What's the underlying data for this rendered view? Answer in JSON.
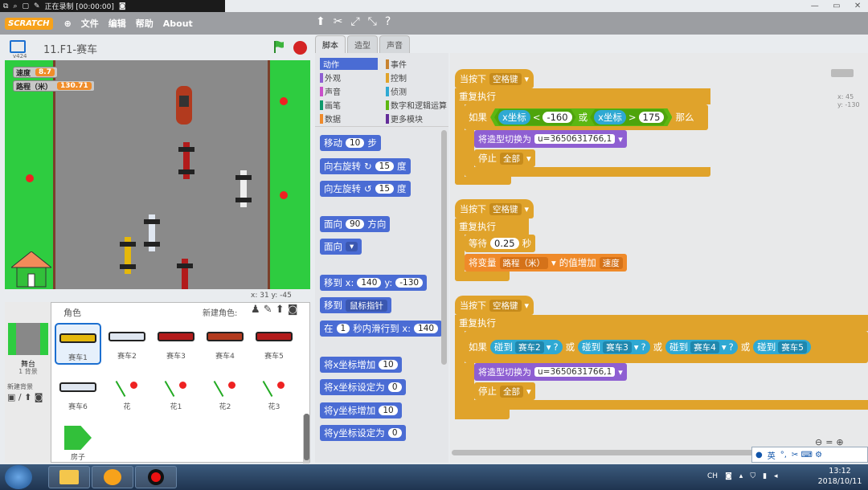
{
  "recording": {
    "status": "正在录制 [00:00:00]"
  },
  "menu": {
    "logo": "SCRATCH",
    "file": "文件",
    "edit": "编辑",
    "help": "帮助",
    "about": "About"
  },
  "stage": {
    "version": "v424",
    "title": "11.F1-赛车",
    "coords": "x: 31   y: -45",
    "var_speed_label": "速度",
    "var_speed_value": "8.7",
    "var_dist_label": "路程（米）",
    "var_dist_value": "130.71"
  },
  "sprites": {
    "header": "角色",
    "new_sprite": "新建角色:",
    "stage_label": "舞台",
    "backdrops": "1 背景",
    "new_backdrop": "新建背景",
    "items": [
      "赛车1",
      "赛车2",
      "赛车3",
      "赛车4",
      "赛车5",
      "赛车6",
      "花",
      "花1",
      "花2",
      "花3",
      "房子"
    ]
  },
  "tabs": [
    "脚本",
    "造型",
    "声音"
  ],
  "categories": {
    "motion": "动作",
    "looks": "外观",
    "sound": "声音",
    "pen": "画笔",
    "data": "数据",
    "events": "事件",
    "control": "控制",
    "sensing": "侦测",
    "operators": "数字和逻辑运算",
    "more": "更多模块"
  },
  "palette": {
    "move": "移动",
    "move_n": "10",
    "steps": "步",
    "turn_r": "向右旋转",
    "turn_r_n": "15",
    "deg": "度",
    "turn_l": "向左旋转",
    "turn_l_n": "15",
    "point_dir": "面向",
    "point_dir_n": "90",
    "direction": "方向",
    "point_towards": "面向",
    "goto_xy": "移到 x:",
    "goto_x": "140",
    "goto_y_lbl": "y:",
    "goto_y": "-130",
    "goto": "移到",
    "goto_target": "鼠标指针",
    "glide": "在",
    "glide_n": "1",
    "glide_txt": "秒内滑行到 x:",
    "glide_x": "140",
    "change_x": "将x坐标增加",
    "change_x_n": "10",
    "set_x": "将x坐标设定为",
    "set_x_n": "0",
    "change_y": "将y坐标增加",
    "change_y_n": "10",
    "set_y": "将y坐标设定为",
    "set_y_n": "0"
  },
  "scripts": {
    "s1": {
      "hat": "当按下",
      "key": "空格键",
      "forever": "重复执行",
      "if": "如果",
      "xpos1": "x坐标",
      "lt": "<",
      "n1": "-160",
      "or": "或",
      "xpos2": "x坐标",
      "gt": ">",
      "n2": "175",
      "then": "那么",
      "switch": "将造型切换为",
      "costume": "u=3650631766,1",
      "stop": "停止",
      "stop_opt": "全部"
    },
    "s2": {
      "hat": "当按下",
      "key": "空格键",
      "forever": "重复执行",
      "wait": "等待",
      "wait_n": "0.25",
      "sec": "秒",
      "change": "将变量",
      "var": "路程（米）",
      "inc": "的值增加",
      "by": "速度"
    },
    "s3": {
      "hat": "当按下",
      "key": "空格键",
      "forever": "重复执行",
      "if": "如果",
      "touch": "碰到",
      "car2": "赛车2",
      "car3": "赛车3",
      "car4": "赛车4",
      "car5": "赛车5",
      "q": "?",
      "or": "或",
      "switch": "将造型切换为",
      "costume": "u=3650631766,1",
      "stop": "停止",
      "stop_opt": "全部"
    },
    "sprite_coords": "x: 45\ny: -130"
  },
  "taskbar": {
    "lang": "CH",
    "time": "13:12",
    "date": "2018/10/11",
    "ime": "英"
  },
  "colors": {
    "motion": "#4a6cd4",
    "events": "#e0a32b",
    "looks": "#8e5fd2",
    "data": "#ef8a2a",
    "operators": "#5cb712",
    "sensing": "#2fa9d3"
  }
}
